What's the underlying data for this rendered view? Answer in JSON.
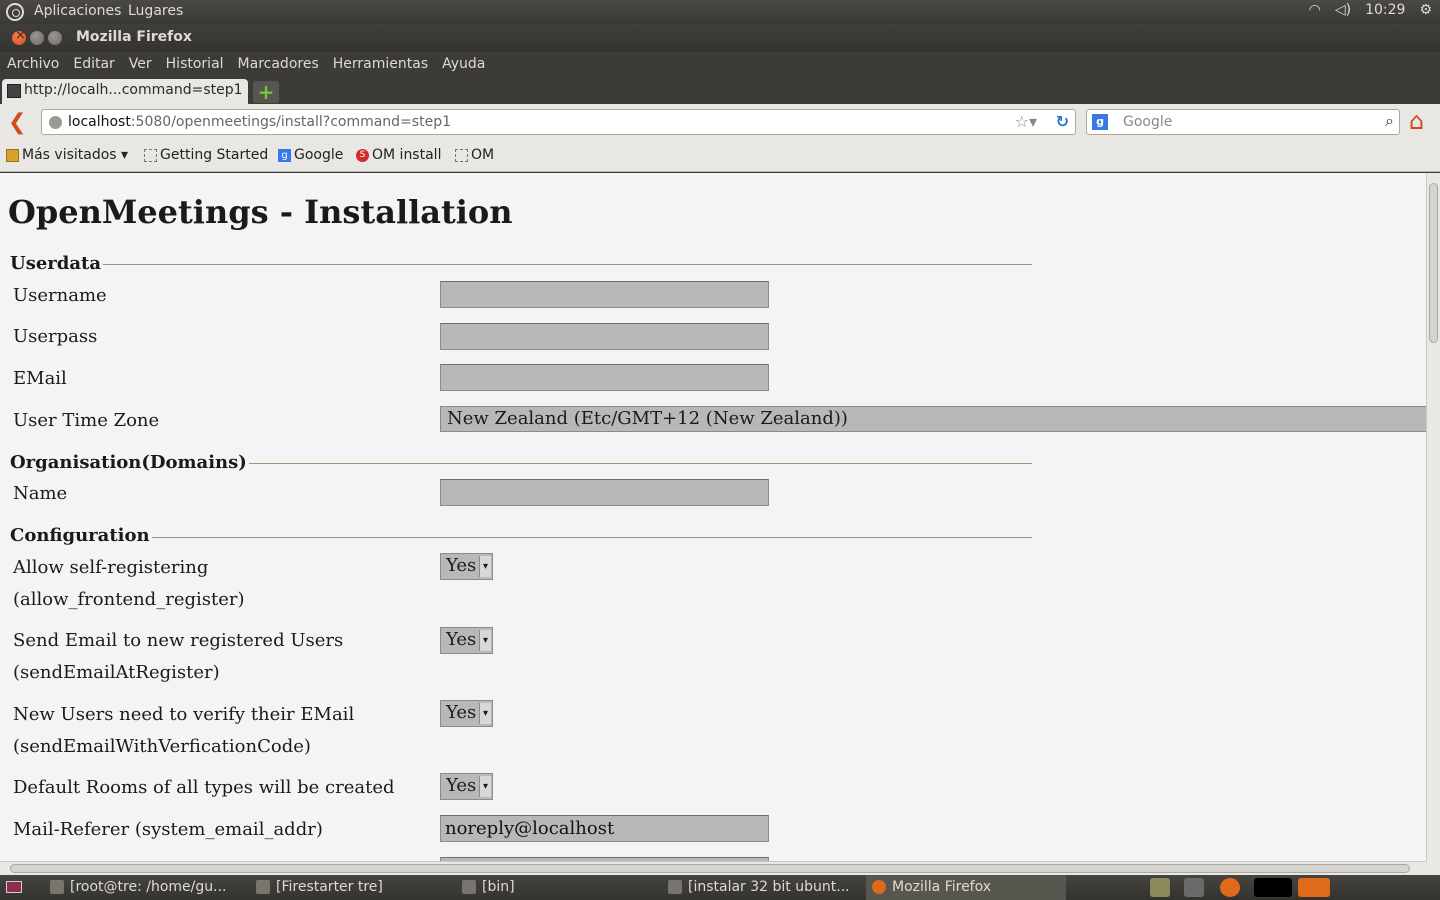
{
  "top_panel": {
    "menu_apps": "Aplicaciones",
    "menu_places": "Lugares",
    "time": "10:29"
  },
  "window": {
    "title": "Mozilla Firefox"
  },
  "menu_bar": {
    "items": [
      "Archivo",
      "Editar",
      "Ver",
      "Historial",
      "Marcadores",
      "Herramientas",
      "Ayuda"
    ]
  },
  "tab": {
    "title": "http://localh...command=step1"
  },
  "nav": {
    "url_host": "localhost",
    "url_rest": ":5080/openmeetings/install?command=step1",
    "search_placeholder": "Google"
  },
  "bookmarks": [
    {
      "label": "Más visitados ▾",
      "icon": "folder-icon"
    },
    {
      "label": "Getting Started",
      "icon": "page-icon"
    },
    {
      "label": "Google",
      "icon": "google-icon"
    },
    {
      "label": "OM install",
      "icon": "om-icon"
    },
    {
      "label": "OM",
      "icon": "page-icon"
    }
  ],
  "page": {
    "title": "OpenMeetings - Installation",
    "sections": {
      "userdata": "Userdata",
      "organisation": "Organisation(Domains)",
      "configuration": "Configuration"
    },
    "fields": {
      "username": {
        "label": "Username",
        "value": ""
      },
      "userpass": {
        "label": "Userpass",
        "value": ""
      },
      "email": {
        "label": "EMail",
        "value": ""
      },
      "timezone": {
        "label": "User Time Zone",
        "value": "New Zealand (Etc/GMT+12 (New Zealand))"
      },
      "org_name": {
        "label": "Name",
        "value": ""
      },
      "self_register": {
        "label": "Allow self-registering",
        "sublabel": "(allow_frontend_register)",
        "value": "Yes"
      },
      "send_email": {
        "label": "Send Email to new registered Users",
        "sublabel": "(sendEmailAtRegister)",
        "value": "Yes"
      },
      "verify_email": {
        "label": "New Users need to verify their EMail",
        "sublabel": "(sendEmailWithVerficationCode)",
        "value": "Yes"
      },
      "default_rooms": {
        "label": "Default Rooms of all types will be created",
        "value": "Yes"
      },
      "mail_referer": {
        "label": "Mail-Referer (system_email_addr)",
        "value": "noreply@localhost"
      }
    }
  },
  "taskbar": {
    "tasks": [
      {
        "label": "[root@tre: /home/gu..."
      },
      {
        "label": "[Firestarter tre]"
      },
      {
        "label": "[bin]"
      },
      {
        "label": "[instalar 32 bit ubunt..."
      },
      {
        "label": "Mozilla Firefox"
      }
    ]
  },
  "colors": {
    "fieldset_line": "#8aa27a",
    "input_bg": "#b8b8b8",
    "accent_firefox": "#d44a1c"
  }
}
